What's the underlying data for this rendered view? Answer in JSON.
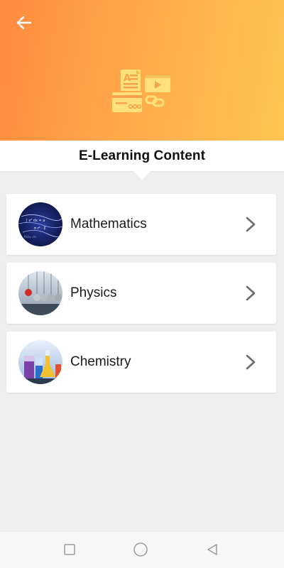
{
  "header": {
    "back_icon": "arrow-left-icon",
    "illustration_icon": "e-learning-content-icon",
    "gradient_start": "#ff8a3d",
    "gradient_end": "#ffc552"
  },
  "title": "E-Learning Content",
  "subjects": [
    {
      "label": "Mathematics",
      "icon": "mathematics-thumbnail"
    },
    {
      "label": "Physics",
      "icon": "physics-thumbnail"
    },
    {
      "label": "Chemistry",
      "icon": "chemistry-thumbnail"
    }
  ],
  "navbar": {
    "recent_icon": "square-icon",
    "home_icon": "circle-icon",
    "back_icon": "triangle-back-icon"
  }
}
